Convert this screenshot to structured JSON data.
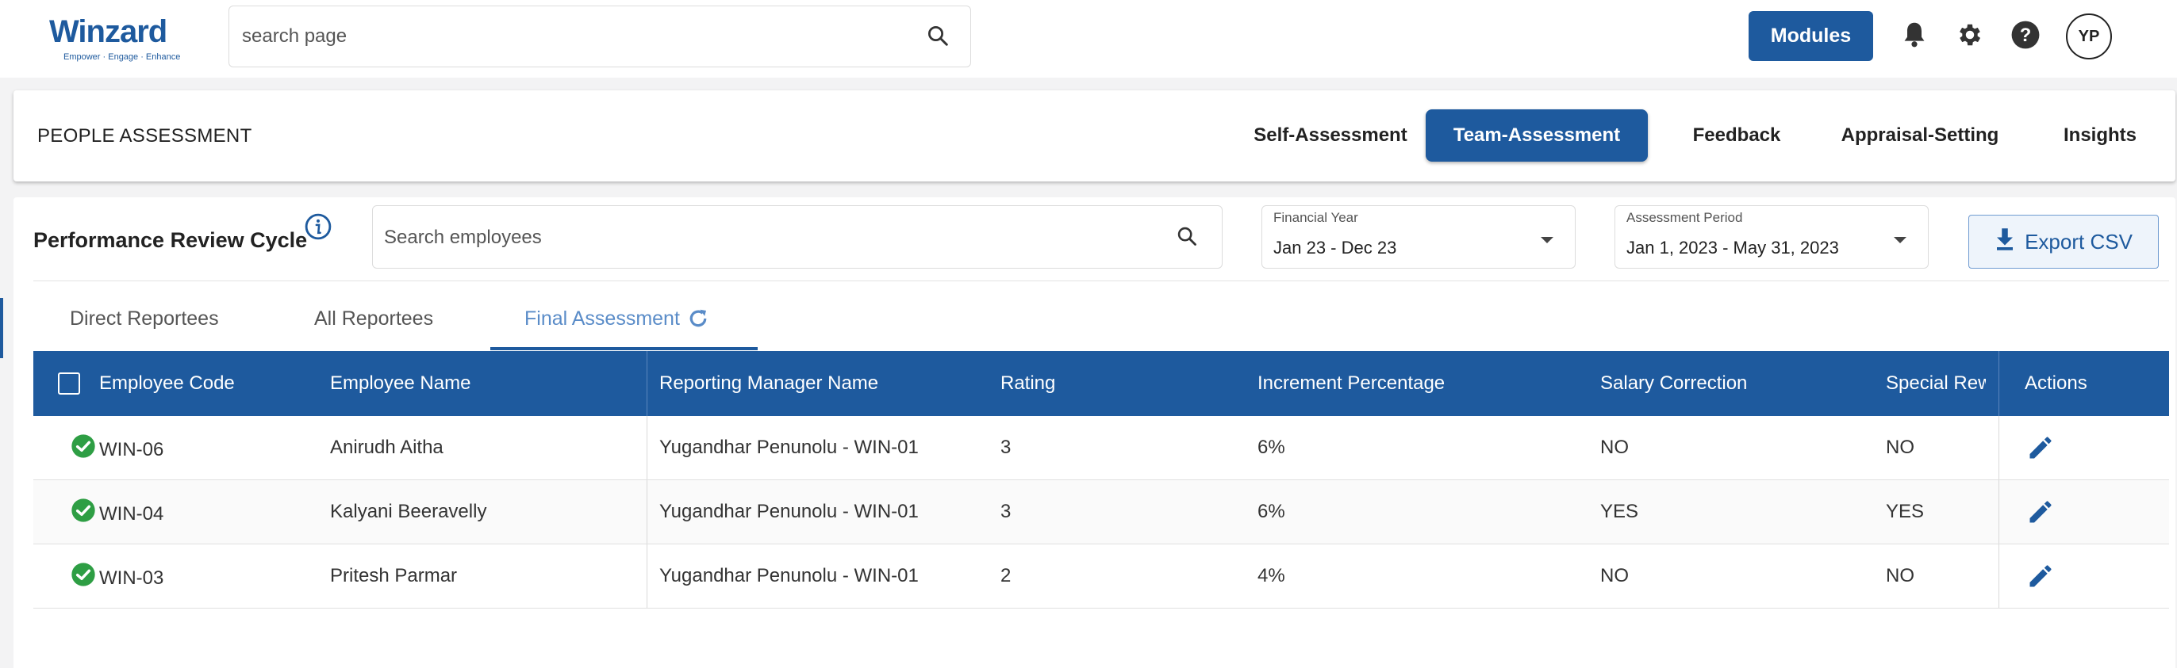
{
  "brand": {
    "name": "Winzard",
    "tagline": "Empower · Engage · Enhance"
  },
  "top_search": {
    "placeholder": "search page"
  },
  "topbar": {
    "modules_label": "Modules",
    "avatar_initials": "YP"
  },
  "page": {
    "title": "PEOPLE ASSESSMENT",
    "nav_tabs": [
      {
        "label": "Self-Assessment",
        "active": false
      },
      {
        "label": "Team-Assessment",
        "active": true
      },
      {
        "label": "Feedback",
        "active": false
      },
      {
        "label": "Appraisal-Setting",
        "active": false
      },
      {
        "label": "Insights",
        "active": false
      }
    ]
  },
  "review": {
    "title": "Performance Review Cycle",
    "search_placeholder": "Search employees",
    "financial_year": {
      "label": "Financial Year",
      "value": "Jan 23 - Dec 23"
    },
    "assessment_period": {
      "label": "Assessment Period",
      "value": "Jan 1, 2023 - May 31, 2023"
    },
    "export_label": "Export CSV",
    "sub_tabs": [
      {
        "label": "Direct Reportees",
        "active": false
      },
      {
        "label": "All Reportees",
        "active": false
      },
      {
        "label": "Final Assessment",
        "active": true
      }
    ]
  },
  "table": {
    "columns": [
      "Employee Code",
      "Employee Name",
      "Reporting Manager Name",
      "Rating",
      "Increment Percentage",
      "Salary Correction",
      "Special Rewa",
      "Actions"
    ],
    "rows": [
      {
        "code": "WIN-06",
        "name": "Anirudh Aitha",
        "manager": "Yugandhar Penunolu - WIN-01",
        "rating": "3",
        "increment": "6%",
        "salary_correction": "NO",
        "special_reward": "NO"
      },
      {
        "code": "WIN-04",
        "name": "Kalyani Beeravelly",
        "manager": "Yugandhar Penunolu - WIN-01",
        "rating": "3",
        "increment": "6%",
        "salary_correction": "YES",
        "special_reward": "YES"
      },
      {
        "code": "WIN-03",
        "name": "Pritesh Parmar",
        "manager": "Yugandhar Penunolu - WIN-01",
        "rating": "2",
        "increment": "4%",
        "salary_correction": "NO",
        "special_reward": "NO"
      }
    ]
  },
  "colors": {
    "primary": "#1e5a9e",
    "success": "#2e9e44",
    "accent_light": "#5a8cc8"
  },
  "icons": [
    "search-icon",
    "bell-icon",
    "gear-icon",
    "help-icon",
    "info-icon",
    "chevron-down-icon",
    "download-icon",
    "refresh-icon",
    "check-circle-icon",
    "edit-icon"
  ]
}
